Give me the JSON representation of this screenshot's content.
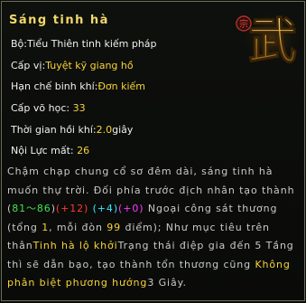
{
  "skill": {
    "name": "Sáng tinh hà",
    "lines": {
      "sect_label": "Bộ:",
      "sect_value": "Tiểu Thiên tinh kiếm pháp",
      "rank_label": "Cấp vị:",
      "rank_value": "Tuyệt kỹ giang hồ",
      "weapon_label": "Hạn chế binh khí:",
      "weapon_value": "Đơn kiếm",
      "level_label": "Cấp võ học: ",
      "level_value": "33",
      "cooldown_label": "Thời gian hồi khí:",
      "cooldown_value": "2.0",
      "cooldown_unit": "giây",
      "mana_label": "Nội Lực mất: ",
      "mana_value": "26"
    },
    "description": {
      "p1": "Chậm chạp chung cổ sơ đêm dài, sáng tinh hà muốn thự trời. Đối phía trước địch nhân tạo thành (",
      "range": "81～86",
      "close_paren": ")",
      "bonus_red": "(+12)",
      "bonus_cyan": "(+4)",
      "bonus_magenta": "(+0)",
      "p2": " Ngoại công sát thương (tổng ",
      "total": "1",
      "p3": ", mỗi đòn ",
      "per_hit": "99",
      "p4": " điểm); Như mục tiêu trên thân",
      "status": "Tinh hà lộ khởi",
      "p5": "Trạng thái điệp gia đến 5 Tầng thì sẽ dẫn bạo, tạo thành tổn thương cũng ",
      "type": "Không phân biệt phương hướng",
      "duration": "3",
      "p6": " Giây."
    }
  },
  "emblem": {
    "seal_char": "宗",
    "main_char": "武"
  },
  "colors": {
    "title": "#f2d86a",
    "value": "#f7d43a",
    "green": "#43e24a",
    "red": "#ff3a2f",
    "cyan": "#34e8ff",
    "magenta": "#ff3dff",
    "border": "#6b6e5a"
  }
}
